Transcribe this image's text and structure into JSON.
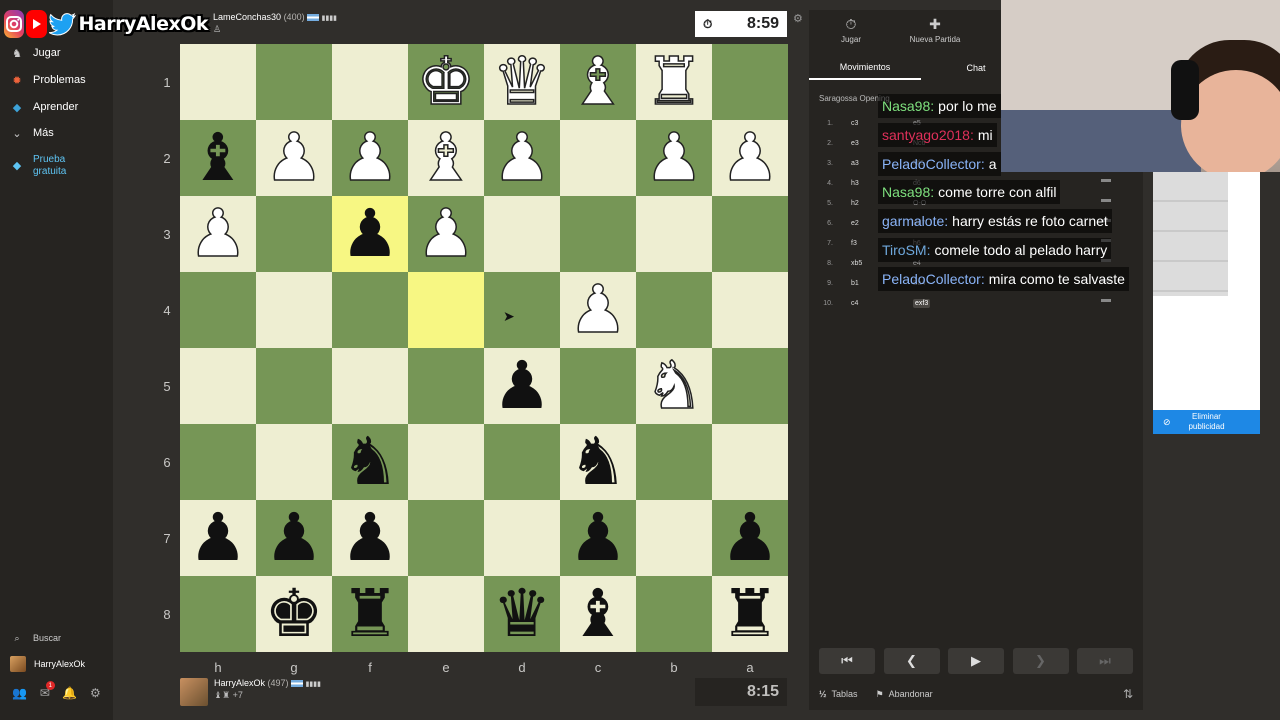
{
  "social": {
    "brand": "HarryAlexOk"
  },
  "sidebar": {
    "items": [
      {
        "label": "Jugar",
        "icon": "play-icon",
        "glyph": "♞"
      },
      {
        "label": "Problemas",
        "icon": "puzzle-icon",
        "glyph": "✹"
      },
      {
        "label": "Aprender",
        "icon": "learn-icon",
        "glyph": "◆"
      },
      {
        "label": "Más",
        "icon": "more-icon",
        "glyph": "⌄"
      }
    ],
    "trial": {
      "line1": "Prueba",
      "line2": "gratuita"
    },
    "search_label": "Buscar",
    "user_label": "HarryAlexOk",
    "notification_count": "1"
  },
  "opponent": {
    "name": "LameConchas30",
    "rating": "(400)",
    "clock": "8:59"
  },
  "me": {
    "name": "HarryAlexOk",
    "rating": "(497)",
    "captured_extra": "+7",
    "clock": "8:15"
  },
  "board": {
    "files": [
      "h",
      "g",
      "f",
      "e",
      "d",
      "c",
      "b",
      "a"
    ],
    "ranks": [
      "1",
      "2",
      "3",
      "4",
      "5",
      "6",
      "7",
      "8"
    ],
    "squares": [
      [
        "",
        "",
        "",
        "wK",
        "wQ",
        "wB",
        "wR",
        ""
      ],
      [
        "bB",
        "wP",
        "wP",
        "wB",
        "wP",
        "",
        "wP",
        "wP"
      ],
      [
        "wP",
        "",
        "bP",
        "wP",
        "",
        "",
        "",
        ""
      ],
      [
        "",
        "",
        "",
        "",
        "",
        "wP",
        "",
        ""
      ],
      [
        "",
        "",
        "",
        "",
        "bP",
        "",
        "wN",
        ""
      ],
      [
        "",
        "",
        "bN",
        "",
        "",
        "bN",
        "",
        ""
      ],
      [
        "bP",
        "bP",
        "bP",
        "",
        "",
        "bP",
        "",
        "bP"
      ],
      [
        "",
        "bK",
        "bR",
        "",
        "bQ",
        "bB",
        "",
        "bR"
      ]
    ],
    "highlights": [
      "2,2",
      "3,3"
    ]
  },
  "panel": {
    "tabs": [
      {
        "label": "Jugar",
        "icon": "clock-icon",
        "glyph": "⏱"
      },
      {
        "label": "Nueva Partida",
        "icon": "plus-icon",
        "glyph": "✚"
      }
    ],
    "subtabs": [
      "Movimientos",
      "Chat"
    ],
    "opening": "Saragossa Opening",
    "moves": [
      {
        "n": "1.",
        "w": "c3",
        "b": "e5"
      },
      {
        "n": "2.",
        "w": "e3",
        "b": "Nc6"
      },
      {
        "n": "3.",
        "w": "a3",
        "b": "Nf6"
      },
      {
        "n": "4.",
        "w": "h3",
        "b": "d6"
      },
      {
        "n": "5.",
        "w": "h2",
        "b": "O-O"
      },
      {
        "n": "6.",
        "w": "e2",
        "b": "Bd7"
      },
      {
        "n": "7.",
        "w": "f3",
        "b": "h6"
      },
      {
        "n": "8.",
        "w": "xb5",
        "b": "e4"
      },
      {
        "n": "9.",
        "w": "b1",
        "b": "Ba4"
      },
      {
        "n": "10.",
        "w": "c4",
        "b": "exf3"
      }
    ],
    "footer": {
      "draw": "Tablas",
      "resign": "Abandonar"
    }
  },
  "chat": [
    {
      "user": "Nasa98:",
      "msg": "por lo me",
      "color": "#7ee07e"
    },
    {
      "user": "santyago2018:",
      "msg": "mi",
      "color": "#e0305a"
    },
    {
      "user": "PeladoCollector:",
      "msg": "a",
      "color": "#8ab4f8"
    },
    {
      "user": "Nasa98:",
      "msg": "come torre con alfil",
      "color": "#7ee07e"
    },
    {
      "user": "garmalote:",
      "msg": "harry estás re foto carnet",
      "color": "#8ab4f8"
    },
    {
      "user": "TiroSM:",
      "msg": "comele todo al pelado harry",
      "color": "#6fa8dc"
    },
    {
      "user": "PeladoCollector:",
      "msg": "mira como te salvaste",
      "color": "#8ab4f8"
    }
  ],
  "ad": {
    "remove_line1": "Eliminar",
    "remove_line2": "publicidad"
  }
}
